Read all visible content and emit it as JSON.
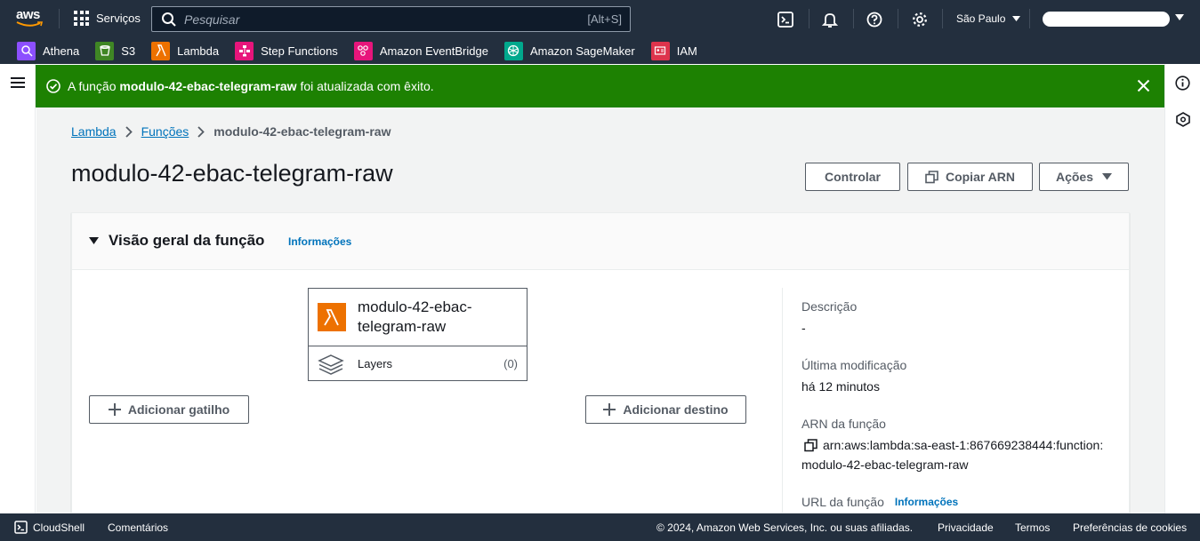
{
  "topnav": {
    "logo_text": "aws",
    "services_label": "Serviços",
    "search_placeholder": "Pesquisar",
    "search_shortcut": "[Alt+S]",
    "region_label": "São Paulo"
  },
  "favorites": [
    {
      "label": "Athena",
      "icon": "athena-icon",
      "color": "#8c4fff"
    },
    {
      "label": "S3",
      "icon": "s3-icon",
      "color": "#3f8624"
    },
    {
      "label": "Lambda",
      "icon": "lambda-icon",
      "color": "#ed7100"
    },
    {
      "label": "Step Functions",
      "icon": "step-functions-icon",
      "color": "#e7157b"
    },
    {
      "label": "Amazon EventBridge",
      "icon": "eventbridge-icon",
      "color": "#e7157b"
    },
    {
      "label": "Amazon SageMaker",
      "icon": "sagemaker-icon",
      "color": "#01a88d"
    },
    {
      "label": "IAM",
      "icon": "iam-icon",
      "color": "#dd344c"
    }
  ],
  "flash": {
    "prefix": "A função ",
    "function_name": "modulo-42-ebac-telegram-raw",
    "suffix": " foi atualizada com êxito.",
    "color": "#1d8102"
  },
  "breadcrumb": {
    "lambda": "Lambda",
    "functions": "Funções",
    "current": "modulo-42-ebac-telegram-raw"
  },
  "page": {
    "title": "modulo-42-ebac-telegram-raw",
    "throttle_label": "Controlar",
    "copy_arn_label": "Copiar ARN",
    "actions_label": "Ações"
  },
  "overview": {
    "title": "Visão geral da função",
    "info_link": "Informações",
    "function_line1": "modulo-42-ebac-",
    "function_line2": "telegram-raw",
    "layers_label": "Layers",
    "layers_count": "(0)",
    "add_trigger_label": "Adicionar gatilho",
    "add_destination_label": "Adicionar destino",
    "description_label": "Descrição",
    "description_value": "-",
    "last_modified_label": "Última modificação",
    "last_modified_value": "há 12 minutos",
    "arn_label": "ARN da função",
    "arn_line1": "arn:aws:lambda:sa-east-1:867669238444:function:",
    "arn_line2": "modulo-42-ebac-telegram-raw",
    "url_label": "URL da função",
    "url_info_link": "Informações"
  },
  "footer": {
    "cloudshell": "CloudShell",
    "feedback": "Comentários",
    "copyright": "© 2024, Amazon Web Services, Inc. ou suas afiliadas.",
    "privacy": "Privacidade",
    "terms": "Termos",
    "cookies": "Preferências de cookies"
  }
}
